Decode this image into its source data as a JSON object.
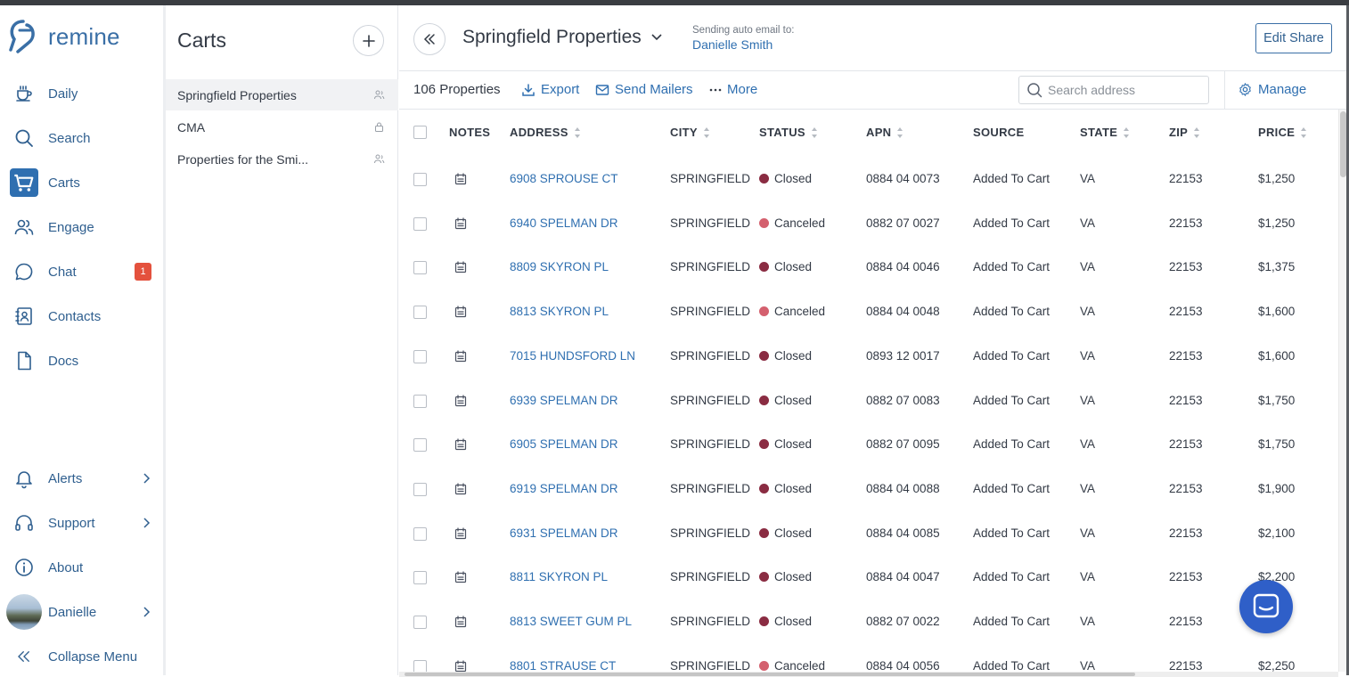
{
  "brand": {
    "name": "remine"
  },
  "nav": {
    "items": [
      {
        "label": "Daily",
        "icon": "coffee-icon"
      },
      {
        "label": "Search",
        "icon": "search-icon"
      },
      {
        "label": "Carts",
        "icon": "cart-icon"
      },
      {
        "label": "Engage",
        "icon": "people-icon"
      },
      {
        "label": "Chat",
        "icon": "chat-icon",
        "badge": "1"
      },
      {
        "label": "Contacts",
        "icon": "contacts-icon"
      },
      {
        "label": "Docs",
        "icon": "document-icon"
      }
    ],
    "bottom": [
      {
        "label": "Alerts",
        "icon": "bell-icon"
      },
      {
        "label": "Support",
        "icon": "headset-icon"
      },
      {
        "label": "About",
        "icon": "info-icon"
      },
      {
        "label": "Danielle",
        "icon": "avatar"
      },
      {
        "label": "Collapse Menu",
        "icon": "double-chevron-left-icon"
      }
    ]
  },
  "carts_panel": {
    "title": "Carts",
    "items": [
      {
        "label": "Springfield Properties",
        "icon": "shared-users-icon"
      },
      {
        "label": "CMA",
        "icon": "lock-icon"
      },
      {
        "label": "Properties for the Smi...",
        "icon": "shared-users-icon"
      }
    ]
  },
  "header": {
    "cart_name": "Springfield Properties",
    "sending_label": "Sending auto email to:",
    "sending_to": "Danielle Smith",
    "edit_share": "Edit Share"
  },
  "toolbar": {
    "count": "106 Properties",
    "export": "Export",
    "send_mailers": "Send Mailers",
    "more": "More",
    "search_placeholder": "Search address",
    "manage": "Manage"
  },
  "table": {
    "columns": [
      "NOTES",
      "ADDRESS",
      "CITY",
      "STATUS",
      "APN",
      "SOURCE",
      "STATE",
      "ZIP",
      "PRICE"
    ],
    "rows": [
      {
        "address": "6908 SPROUSE CT",
        "city": "SPRINGFIELD",
        "status": "Closed",
        "apn": "0884 04 0073",
        "source": "Added To Cart",
        "state": "VA",
        "zip": "22153",
        "price": "$1,250"
      },
      {
        "address": "6940 SPELMAN DR",
        "city": "SPRINGFIELD",
        "status": "Canceled",
        "apn": "0882 07 0027",
        "source": "Added To Cart",
        "state": "VA",
        "zip": "22153",
        "price": "$1,250"
      },
      {
        "address": "8809 SKYRON PL",
        "city": "SPRINGFIELD",
        "status": "Closed",
        "apn": "0884 04 0046",
        "source": "Added To Cart",
        "state": "VA",
        "zip": "22153",
        "price": "$1,375"
      },
      {
        "address": "8813 SKYRON PL",
        "city": "SPRINGFIELD",
        "status": "Canceled",
        "apn": "0884 04 0048",
        "source": "Added To Cart",
        "state": "VA",
        "zip": "22153",
        "price": "$1,600"
      },
      {
        "address": "7015 HUNDSFORD LN",
        "city": "SPRINGFIELD",
        "status": "Closed",
        "apn": "0893 12 0017",
        "source": "Added To Cart",
        "state": "VA",
        "zip": "22153",
        "price": "$1,600"
      },
      {
        "address": "6939 SPELMAN DR",
        "city": "SPRINGFIELD",
        "status": "Closed",
        "apn": "0882 07 0083",
        "source": "Added To Cart",
        "state": "VA",
        "zip": "22153",
        "price": "$1,750"
      },
      {
        "address": "6905 SPELMAN DR",
        "city": "SPRINGFIELD",
        "status": "Closed",
        "apn": "0882 07 0095",
        "source": "Added To Cart",
        "state": "VA",
        "zip": "22153",
        "price": "$1,750"
      },
      {
        "address": "6919 SPELMAN DR",
        "city": "SPRINGFIELD",
        "status": "Closed",
        "apn": "0884 04 0088",
        "source": "Added To Cart",
        "state": "VA",
        "zip": "22153",
        "price": "$1,900"
      },
      {
        "address": "6931 SPELMAN DR",
        "city": "SPRINGFIELD",
        "status": "Closed",
        "apn": "0884 04 0085",
        "source": "Added To Cart",
        "state": "VA",
        "zip": "22153",
        "price": "$2,100"
      },
      {
        "address": "8811 SKYRON PL",
        "city": "SPRINGFIELD",
        "status": "Closed",
        "apn": "0884 04 0047",
        "source": "Added To Cart",
        "state": "VA",
        "zip": "22153",
        "price": "$2,200"
      },
      {
        "address": "8813 SWEET GUM PL",
        "city": "SPRINGFIELD",
        "status": "Closed",
        "apn": "0882 07 0022",
        "source": "Added To Cart",
        "state": "VA",
        "zip": "22153",
        "price": ""
      },
      {
        "address": "8801 STRAUSE CT",
        "city": "SPRINGFIELD",
        "status": "Canceled",
        "apn": "0884 04 0056",
        "source": "Added To Cart",
        "state": "VA",
        "zip": "22153",
        "price": "$2,250"
      }
    ]
  },
  "colors": {
    "accent": "#2f6fb0",
    "closed": "#8a2c42",
    "canceled": "#d4606e",
    "badge": "#e4513d",
    "fab": "#2f5fc8"
  }
}
